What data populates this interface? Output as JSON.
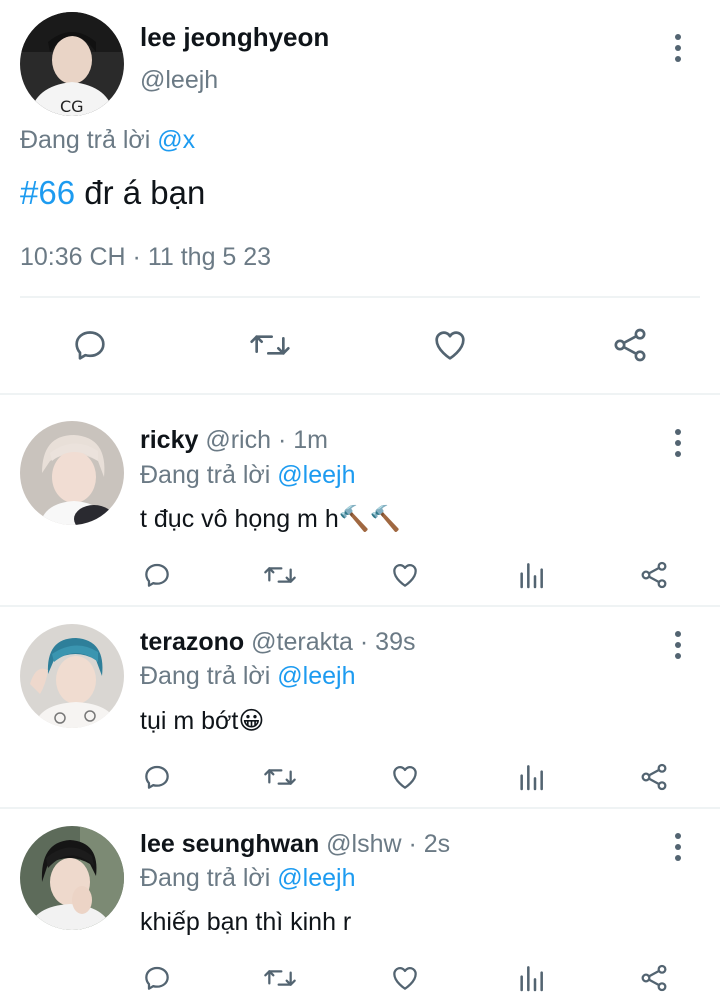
{
  "main_tweet": {
    "display_name": "lee jeonghyeon",
    "handle": "@leejh",
    "reply_prefix": "Đang trả lời",
    "reply_to": "@x",
    "hashtag": "#66",
    "text": " đr á bạn",
    "timestamp": "10:36 CH · 11 thg 5 23"
  },
  "replies": [
    {
      "display_name": "ricky",
      "handle": "@rich",
      "time": " · 1m",
      "reply_prefix": "Đang trả lời",
      "reply_to": "@leejh",
      "text": "t đục vô họng m h",
      "emoji": "🔨🔨"
    },
    {
      "display_name": "terazono",
      "handle": "@terakta",
      "time": " · 39s",
      "reply_prefix": "Đang trả lời",
      "reply_to": "@leejh",
      "text": "tụi m bớt",
      "emoji": "😀"
    },
    {
      "display_name": "lee seunghwan",
      "handle": "@lshw",
      "time": " · 2s",
      "reply_prefix": "Đang trả lời",
      "reply_to": "@leejh",
      "text": "khiếp bạn thì kinh r",
      "emoji": ""
    }
  ],
  "icons": {
    "reply": "reply-icon",
    "retweet": "retweet-icon",
    "like": "heart-icon",
    "views": "views-icon",
    "share": "share-icon",
    "more": "more-icon"
  },
  "colors": {
    "link": "#1d9bf0",
    "muted": "#6b7a85",
    "icon": "#536471",
    "divider": "#eff3f4"
  }
}
